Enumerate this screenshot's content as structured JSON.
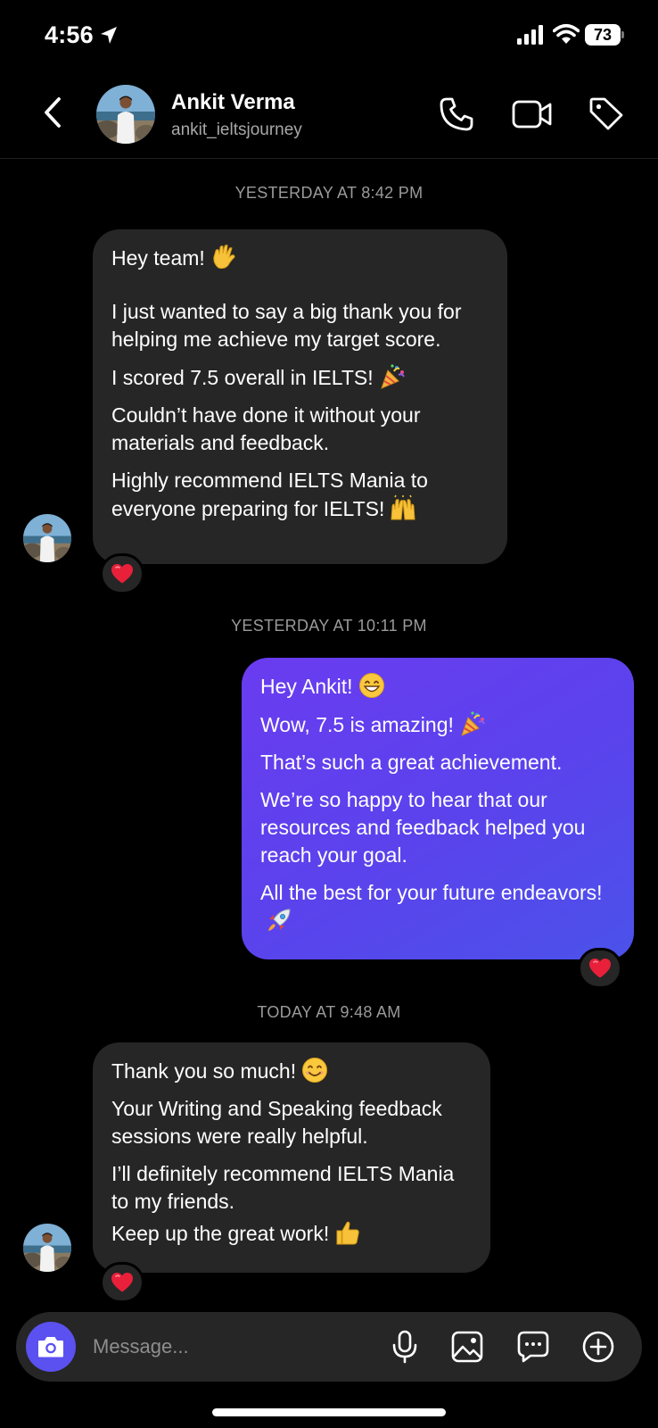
{
  "status_bar": {
    "time": "4:56",
    "battery": "73"
  },
  "header": {
    "name": "Ankit Verma",
    "handle": "ankit_ieltsjourney"
  },
  "messages": {
    "ts1": "YESTERDAY AT 8:42 PM",
    "m1": {
      "l1": "Hey team!",
      "l2": "I just wanted to say a big thank you for helping me achieve my target score.",
      "l3": "I scored 7.5 overall in IELTS!",
      "l4": "Couldn’t have done it without your materials and feedback.",
      "l5": "Highly recommend IELTS Mania to everyone preparing for IELTS!",
      "reaction": "heart"
    },
    "ts2": "YESTERDAY AT 10:11 PM",
    "m2": {
      "l1": "Hey Ankit!",
      "l2": "Wow, 7.5 is amazing!",
      "l3": "That’s such a great achievement.",
      "l4": "We’re so happy to hear that our resources and feedback helped you reach your goal.",
      "l5": "All the best for your future endeavors!",
      "reaction": "heart"
    },
    "ts3": "TODAY AT 9:48 AM",
    "m3": {
      "l1": "Thank you so much!",
      "l2": "Your Writing and Speaking feedback sessions were really helpful.",
      "l3": "I’ll definitely recommend IELTS Mania to my friends.",
      "l4": "Keep up the great work!",
      "reaction": "heart"
    }
  },
  "composer": {
    "placeholder": "Message..."
  },
  "colors": {
    "background": "#000000",
    "incoming_bubble": "#262626",
    "outgoing_start": "#6a3cf0",
    "outgoing_end": "#4b52ea",
    "camera_button": "#5b51f0",
    "heart": "#e8203a"
  }
}
